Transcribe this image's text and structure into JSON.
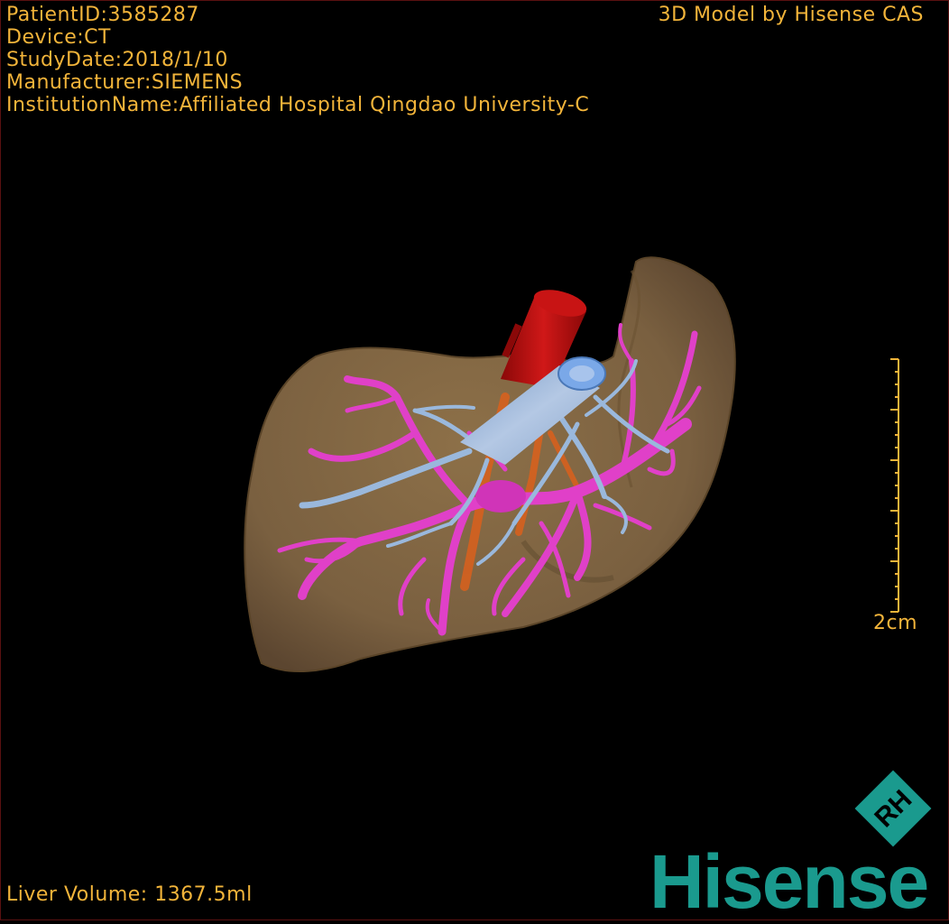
{
  "info": {
    "patient_id": "PatientID:3585287",
    "device": "Device:CT",
    "study_date": "StudyDate:2018/1/10",
    "manufacturer": "Manufacturer:SIEMENS",
    "institution": "InstitutionName:Affiliated Hospital Qingdao University-C"
  },
  "credit": "3D Model by Hisense CAS",
  "volume": "Liver Volume: 1367.5ml",
  "scale_label": "2cm",
  "logo": {
    "word": "Hisense",
    "mark_letters": "RH"
  },
  "colors": {
    "text": "#f2b43a",
    "liver": "#8a6c45",
    "artery": "#c01010",
    "portal_vein": "#e040c8",
    "hepatic_vein": "#9ab8dc",
    "ivc": "#7aa8e8",
    "brand": "#1a9a8e"
  }
}
